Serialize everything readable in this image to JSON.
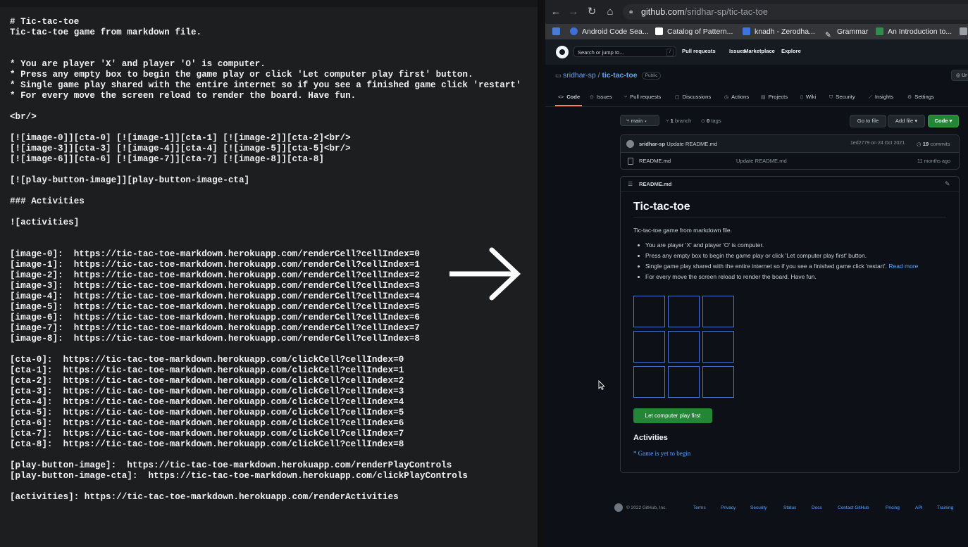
{
  "markdown_source": "# Tic-tac-toe\nTic-tac-toe game from markdown file.\n\n\n* You are player 'X' and player 'O' is computer.\n* Press any empty box to begin the game play or click 'Let computer play first' button.\n* Single game play shared with the entire internet so if you see a finished game click 'restart'\n* For every move the screen reload to render the board. Have fun.\n\n<br/>\n\n[![image-0]][cta-0] [![image-1]][cta-1] [![image-2]][cta-2]<br/>\n[![image-3]][cta-3] [![image-4]][cta-4] [![image-5]][cta-5]<br/>\n[![image-6]][cta-6] [![image-7]][cta-7] [![image-8]][cta-8]\n\n[![play-button-image]][play-button-image-cta]\n\n### Activities\n\n![activities]\n\n\n[image-0]:  https://tic-tac-toe-markdown.herokuapp.com/renderCell?cellIndex=0\n[image-1]:  https://tic-tac-toe-markdown.herokuapp.com/renderCell?cellIndex=1\n[image-2]:  https://tic-tac-toe-markdown.herokuapp.com/renderCell?cellIndex=2\n[image-3]:  https://tic-tac-toe-markdown.herokuapp.com/renderCell?cellIndex=3\n[image-4]:  https://tic-tac-toe-markdown.herokuapp.com/renderCell?cellIndex=4\n[image-5]:  https://tic-tac-toe-markdown.herokuapp.com/renderCell?cellIndex=5\n[image-6]:  https://tic-tac-toe-markdown.herokuapp.com/renderCell?cellIndex=6\n[image-7]:  https://tic-tac-toe-markdown.herokuapp.com/renderCell?cellIndex=7\n[image-8]:  https://tic-tac-toe-markdown.herokuapp.com/renderCell?cellIndex=8\n\n[cta-0]:  https://tic-tac-toe-markdown.herokuapp.com/clickCell?cellIndex=0\n[cta-1]:  https://tic-tac-toe-markdown.herokuapp.com/clickCell?cellIndex=1\n[cta-2]:  https://tic-tac-toe-markdown.herokuapp.com/clickCell?cellIndex=2\n[cta-3]:  https://tic-tac-toe-markdown.herokuapp.com/clickCell?cellIndex=3\n[cta-4]:  https://tic-tac-toe-markdown.herokuapp.com/clickCell?cellIndex=4\n[cta-5]:  https://tic-tac-toe-markdown.herokuapp.com/clickCell?cellIndex=5\n[cta-6]:  https://tic-tac-toe-markdown.herokuapp.com/clickCell?cellIndex=6\n[cta-7]:  https://tic-tac-toe-markdown.herokuapp.com/clickCell?cellIndex=7\n[cta-8]:  https://tic-tac-toe-markdown.herokuapp.com/clickCell?cellIndex=8\n\n[play-button-image]:  https://tic-tac-toe-markdown.herokuapp.com/renderPlayControls\n[play-button-image-cta]:  https://tic-tac-toe-markdown.herokuapp.com/clickPlayControls\n\n[activities]: https://tic-tac-toe-markdown.herokuapp.com/renderActivities",
  "arrow_icon": "right-arrow-icon",
  "browser": {
    "url_host": "github.com",
    "url_path": "/sridhar-sp/tic-tac-toe",
    "bookmarks": [
      "Android Code Sea...",
      "Catalog of Pattern...",
      "knadh - Zerodha...",
      "Grammar",
      "An Introduction to..."
    ]
  },
  "github": {
    "search_placeholder": "Search or jump to...",
    "search_key": "/",
    "nav": [
      "Pull requests",
      "Issues",
      "Marketplace",
      "Explore"
    ],
    "owner": "sridhar-sp",
    "repo": "tic-tac-toe",
    "visibility": "Public",
    "watch_label": "Ur",
    "tabs": [
      "Code",
      "Issues",
      "Pull requests",
      "Discussions",
      "Actions",
      "Projects",
      "Wiki",
      "Security",
      "Insights",
      "Settings"
    ],
    "branch": "main",
    "branch_count": "1",
    "branch_word": "branch",
    "tag_count": "0",
    "tag_word": "tags",
    "goto_file": "Go to file",
    "add_file": "Add file",
    "code_label": "Code",
    "commit_author": "sridhar-sp",
    "commit_message": "Update README.md",
    "commit_hash": "1ed2779",
    "commit_date": "on 24 Oct 2021",
    "commit_count": "19",
    "commit_word": "commits",
    "file_name": "README.md",
    "file_commit": "Update README.md",
    "file_age": "11 months ago"
  },
  "readme": {
    "file_label": "README.md",
    "title": "Tic-tac-toe",
    "description": "Tic-tac-toe game from markdown file.",
    "bullets": [
      "You are player 'X' and player 'O' is computer.",
      "Press any empty box to begin the game play or click 'Let computer play first' button.",
      "Single game play shared with the entire internet so if you see a finished game click 'restart'.",
      "For every move the screen reload to render the board. Have fun."
    ],
    "read_more": "Read more",
    "play_button": "Let computer play first",
    "activities_heading": "Activities",
    "activities_text": "* Game is yet to begin"
  },
  "footer": {
    "copyright": "© 2022 GitHub, Inc.",
    "links": [
      "Terms",
      "Privacy",
      "Security",
      "Status",
      "Docs",
      "Contact GitHub",
      "Pricing",
      "API",
      "Training"
    ]
  },
  "colors": {
    "accent_green": "#238636",
    "link_blue": "#58a6ff",
    "cell_border": "#4b74d0",
    "tab_underline": "#f78166"
  }
}
